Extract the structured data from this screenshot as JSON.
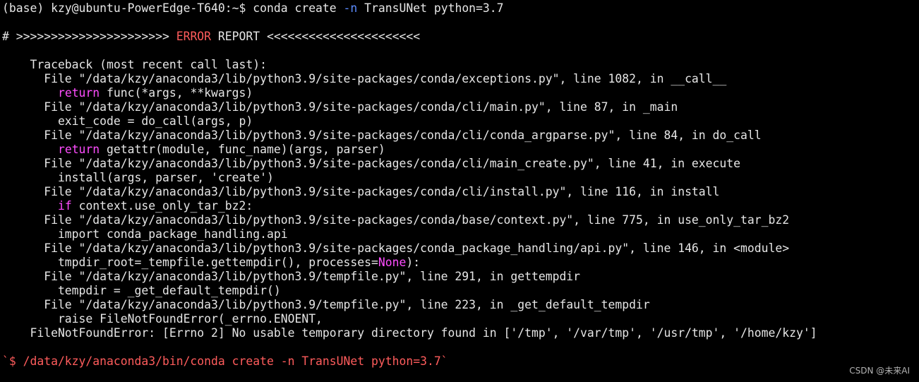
{
  "prompt": {
    "prefix": "(base) kzy@ubuntu-PowerEdge-T640:~$ conda create ",
    "flag": "-n",
    "suffix": " TransUNet python=3.7"
  },
  "error_report": {
    "prefix": "# >>>>>>>>>>>>>>>>>>>>>> ",
    "error_word": "ERROR",
    "suffix": " REPORT <<<<<<<<<<<<<<<<<<<<<<"
  },
  "traceback": {
    "header": "    Traceback (most recent call last):",
    "l1": "      File \"/data/kzy/anaconda3/lib/python3.9/site-packages/conda/exceptions.py\", line 1082, in __call__",
    "l2_kw": "return",
    "l2_rest": " func(*args, **kwargs)",
    "l3": "      File \"/data/kzy/anaconda3/lib/python3.9/site-packages/conda/cli/main.py\", line 87, in _main",
    "l4": "        exit_code = do_call(args, p)",
    "l5": "      File \"/data/kzy/anaconda3/lib/python3.9/site-packages/conda/cli/conda_argparse.py\", line 84, in do_call",
    "l6_kw": "return",
    "l6_rest": " getattr(module, func_name)(args, parser)",
    "l7": "      File \"/data/kzy/anaconda3/lib/python3.9/site-packages/conda/cli/main_create.py\", line 41, in execute",
    "l8": "        install(args, parser, 'create')",
    "l9": "      File \"/data/kzy/anaconda3/lib/python3.9/site-packages/conda/cli/install.py\", line 116, in install",
    "l10_kw": "if",
    "l10_rest": " context.use_only_tar_bz2:",
    "l11": "      File \"/data/kzy/anaconda3/lib/python3.9/site-packages/conda/base/context.py\", line 775, in use_only_tar_bz2",
    "l12": "        import conda_package_handling.api",
    "l13": "      File \"/data/kzy/anaconda3/lib/python3.9/site-packages/conda_package_handling/api.py\", line 146, in <module>",
    "l14_pre": "        tmpdir_root=_tempfile.gettempdir(), processes=",
    "l14_kw": "None",
    "l14_post": "):",
    "l15": "      File \"/data/kzy/anaconda3/lib/python3.9/tempfile.py\", line 291, in gettempdir",
    "l16": "        tempdir = _get_default_tempdir()",
    "l17": "      File \"/data/kzy/anaconda3/lib/python3.9/tempfile.py\", line 223, in _get_default_tempdir",
    "l18": "        raise FileNotFoundError(_errno.ENOENT,",
    "l19": "    FileNotFoundError: [Errno 2] No usable temporary directory found in ['/tmp', '/var/tmp', '/usr/tmp', '/home/kzy']"
  },
  "command_echo": "`$ /data/kzy/anaconda3/bin/conda create -n TransUNet python=3.7`",
  "watermark": "CSDN @未来AI",
  "colors": {
    "background": "#000000",
    "text": "#e6e6e6",
    "error": "#ff5c5c",
    "keyword": "#ff4dff",
    "flag": "#5c8cff"
  }
}
